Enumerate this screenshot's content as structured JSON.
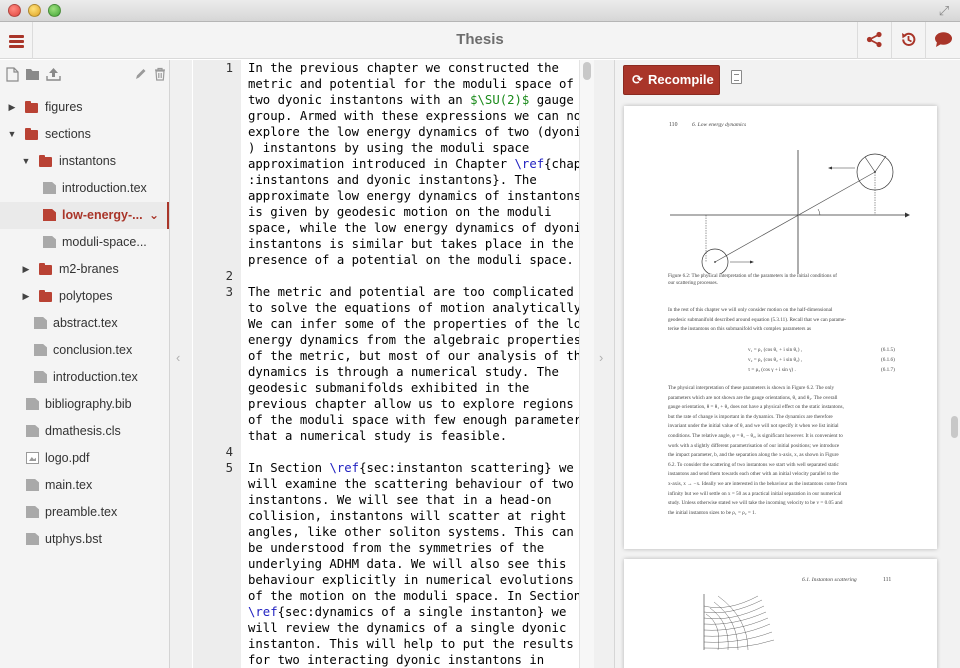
{
  "window": {
    "title": "Thesis"
  },
  "toolbar": {
    "menu_icon": "hamburger-icon",
    "right_icons": [
      "share-icon",
      "history-icon",
      "chat-icon"
    ]
  },
  "file_tree": {
    "toolbar_icons": [
      "new-file-icon",
      "new-folder-icon",
      "upload-icon",
      "rename-icon",
      "delete-icon"
    ],
    "items": [
      {
        "label": "figures",
        "type": "folder",
        "expanded": false,
        "depth": 0
      },
      {
        "label": "sections",
        "type": "folder",
        "expanded": true,
        "depth": 0
      },
      {
        "label": "instantons",
        "type": "folder",
        "expanded": true,
        "depth": 1
      },
      {
        "label": "introduction.tex",
        "type": "file",
        "depth": 2
      },
      {
        "label": "low-energy-...",
        "type": "file",
        "depth": 2,
        "selected": true
      },
      {
        "label": "moduli-space...",
        "type": "file",
        "depth": 2
      },
      {
        "label": "m2-branes",
        "type": "folder",
        "expanded": false,
        "depth": 1
      },
      {
        "label": "polytopes",
        "type": "folder",
        "expanded": false,
        "depth": 1
      },
      {
        "label": "abstract.tex",
        "type": "file",
        "depth": 1
      },
      {
        "label": "conclusion.tex",
        "type": "file",
        "depth": 1
      },
      {
        "label": "introduction.tex",
        "type": "file",
        "depth": 1
      },
      {
        "label": "bibliography.bib",
        "type": "file",
        "depth": 0
      },
      {
        "label": "dmathesis.cls",
        "type": "file",
        "depth": 0
      },
      {
        "label": "logo.pdf",
        "type": "image",
        "depth": 0
      },
      {
        "label": "main.tex",
        "type": "file",
        "depth": 0
      },
      {
        "label": "preamble.tex",
        "type": "file",
        "depth": 0
      },
      {
        "label": "utphys.bst",
        "type": "file",
        "depth": 0
      }
    ]
  },
  "editor": {
    "lines": [
      {
        "n": "1",
        "text": "In the previous chapter we constructed the"
      },
      {
        "n": "",
        "text": "metric and potential for the moduli space of"
      },
      {
        "n": "",
        "text": "two dyonic instantons with an ",
        "math": "$\\SU(2)$",
        "after": " gauge"
      },
      {
        "n": "",
        "text": "group. Armed with these expressions we can now"
      },
      {
        "n": "",
        "text": "explore the low energy dynamics of two (dyonic"
      },
      {
        "n": "",
        "text": ") instantons by using the moduli space"
      },
      {
        "n": "",
        "text": "approximation introduced in Chapter ",
        "kw": "\\ref",
        "after": "{chap"
      },
      {
        "n": "",
        "text": ":instantons and dyonic instantons}. The"
      },
      {
        "n": "",
        "text": "approximate low energy dynamics of instantons"
      },
      {
        "n": "",
        "text": "is given by geodesic motion on the moduli"
      },
      {
        "n": "",
        "text": "space, while the low energy dynamics of dyonic"
      },
      {
        "n": "",
        "text": "instantons is similar but takes place in the"
      },
      {
        "n": "",
        "text": "presence of a potential on the moduli space."
      },
      {
        "n": "2",
        "text": ""
      },
      {
        "n": "3",
        "text": "The metric and potential are too complicated"
      },
      {
        "n": "",
        "text": "to solve the equations of motion analytically."
      },
      {
        "n": "",
        "text": "We can infer some of the properties of the low"
      },
      {
        "n": "",
        "text": "energy dynamics from the algebraic properties"
      },
      {
        "n": "",
        "text": "of the metric, but most of our analysis of the"
      },
      {
        "n": "",
        "text": "dynamics is through a numerical study. The"
      },
      {
        "n": "",
        "text": "geodesic submanifolds exhibited in the"
      },
      {
        "n": "",
        "text": "previous chapter allow us to explore regions"
      },
      {
        "n": "",
        "text": "of the moduli space with few enough parameters"
      },
      {
        "n": "",
        "text": "that a numerical study is feasible."
      },
      {
        "n": "4",
        "text": ""
      },
      {
        "n": "5",
        "text": "In Section ",
        "kw": "\\ref",
        "after": "{sec:instanton scattering} we"
      },
      {
        "n": "",
        "text": "will examine the scattering behaviour of two"
      },
      {
        "n": "",
        "text": "instantons. We will see that in a head-on"
      },
      {
        "n": "",
        "text": "collision, instantons will scatter at right"
      },
      {
        "n": "",
        "text": "angles, like other soliton systems. This can"
      },
      {
        "n": "",
        "text": "be understood from the symmetries of the"
      },
      {
        "n": "",
        "text": "underlying ADHM data. We will also see this"
      },
      {
        "n": "",
        "text": "behaviour explicitly in numerical evolutions"
      },
      {
        "n": "",
        "text": "of the motion on the moduli space. In Section"
      },
      {
        "n": "",
        "text": "",
        "kw": "\\ref",
        "after": "{sec:dynamics of a single instanton} we"
      },
      {
        "n": "",
        "text": "will review the dynamics of a single dyonic"
      },
      {
        "n": "",
        "text": "instanton. This will help to put the results"
      },
      {
        "n": "",
        "text": "for two interacting dyonic instantons in"
      }
    ]
  },
  "pdf": {
    "recompile_label": "Recompile",
    "recompile_icon": "refresh-icon",
    "logs_icon": "document-icon",
    "page1": {
      "page_number": "110",
      "running_head": "6. Low energy dynamics",
      "caption": "Figure 6.2: The physical interpretation of the parameters in the initial conditions of\nour scattering processes.",
      "para1": "In the rest of this chapter we will only consider motion on the half-dimensional\ngeodesic submanifold described around equation (5.3.11). Recall that we can parame-\nterise the instantons on this submanifold with complex parameters as",
      "equations": [
        {
          "lhs": "v₁ = ρ₁ (cos θ₁ + i sin θ₁) ,",
          "tag": "(6.1.5)"
        },
        {
          "lhs": "v₂ = ρ₂ (cos θ₂ + i sin θ₂) ,",
          "tag": "(6.1.6)"
        },
        {
          "lhs": "τ = ρ₃ (cos γ + i sin γ) .",
          "tag": "(6.1.7)"
        }
      ],
      "para2": "The physical interpretation of these parameters is shown in Figure 6.2. The only\nparameters which are not shown are the gauge orientations, θ₁ and θ₂. The overall\ngauge orientation, θ = θ₁ + θ₂ does not have a physical effect on the static instantons,\nbut the rate of change is important in the dynamics. The dynamics are therefore\ninvariant under the initial value of θ, and we will not specify it when we list initial\nconditions. The relative angle, φ = θ₁ − θ₂, is significant however. It is convenient to\nwork with a slightly different parametrisation of our initial positions; we introduce\nthe impact parameter, b, and the separation along the x-axis, x, as shown in Figure\n6.2. To consider the scattering of two instantons we start with well separated static\ninstantons and send them towards each other with an initial velocity parallel to the\nx-axis, x → −x. Ideally we are interested in the behaviour as the instantons come from\ninfinity but we will settle on x = 50 as a practical initial separation in our numerical\nstudy. Unless otherwise stated we will take the incoming velocity to be v = 0.05 and\nthe initial instanton sizes to be ρ₁ = ρ₂ = 1."
    },
    "page2": {
      "running_head": "6.1. Instanton scattering",
      "page_number": "111"
    }
  },
  "colors": {
    "accent": "#a93529",
    "gutter": "#ededed",
    "sidebar": "#f4f4f4"
  }
}
